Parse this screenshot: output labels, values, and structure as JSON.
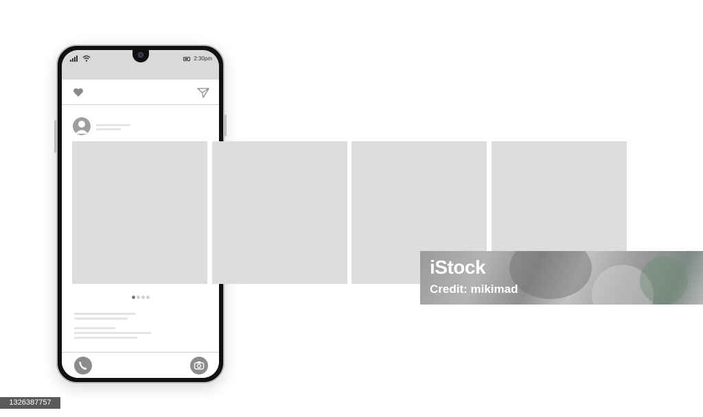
{
  "status_bar": {
    "time": "2:30pm"
  },
  "icons": {
    "signal": "signal-icon",
    "wifi": "wifi-icon",
    "battery": "battery-icon",
    "heart": "heart-icon",
    "send": "send-icon",
    "avatar": "user-avatar-icon",
    "phone": "phone-icon",
    "camera": "camera-icon"
  },
  "carousel": {
    "total_slides": 4,
    "active_index": 0,
    "indicator_dots": 4
  },
  "colors": {
    "status_bar_bg": "#d9d9d9",
    "placeholder": "#dddddd",
    "icon_gray": "#8c8c8c",
    "dot_active": "#7a7a7a",
    "dot_inactive": "#cfcfcf"
  },
  "watermark": {
    "logo": "iStock",
    "credit": "Credit: mikimad"
  },
  "image_id": "1326387757"
}
